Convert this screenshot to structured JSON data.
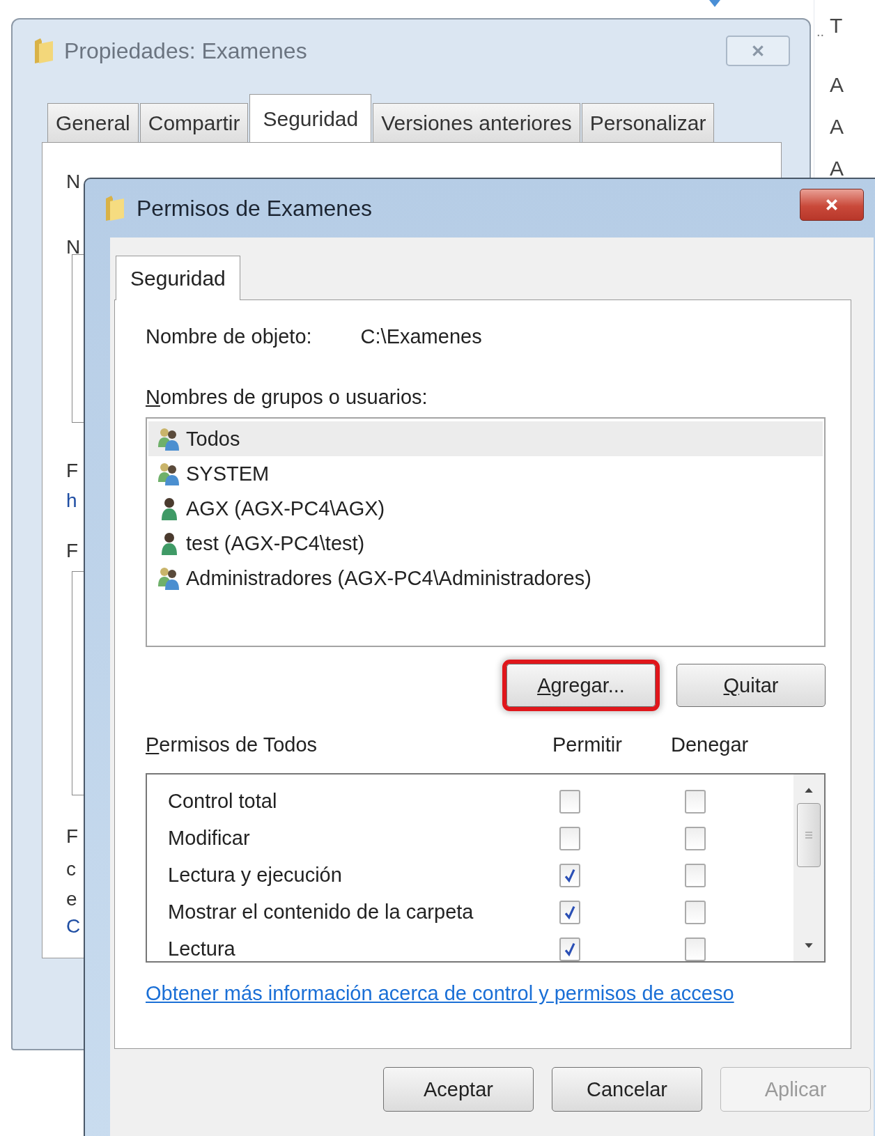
{
  "background_window": {
    "title": "Propiedades: Examenes",
    "tabs": [
      {
        "label": "General",
        "selected": false
      },
      {
        "label": "Compartir",
        "selected": false
      },
      {
        "label": "Seguridad",
        "selected": true
      },
      {
        "label": "Versiones anteriores",
        "selected": false
      },
      {
        "label": "Personalizar",
        "selected": false
      }
    ],
    "clipped_text": [
      {
        "text": "N",
        "kind": "text"
      },
      {
        "text": "N",
        "kind": "text"
      },
      {
        "text": "F",
        "kind": "text"
      },
      {
        "text": "h",
        "kind": "link"
      },
      {
        "text": "F",
        "kind": "text"
      },
      {
        "text": "F",
        "kind": "text"
      },
      {
        "text": "c",
        "kind": "text"
      },
      {
        "text": "e",
        "kind": "text"
      },
      {
        "text": "C",
        "kind": "link"
      }
    ]
  },
  "side_panel": {
    "ellipsis": "..",
    "texts": [
      "T",
      "A",
      "A",
      "A"
    ]
  },
  "dialog": {
    "title": "Permisos de Examenes",
    "tabs": [
      {
        "label": "Seguridad",
        "selected": true
      }
    ],
    "object_name_label": "Nombre de objeto:",
    "object_name": "C:\\Examenes",
    "groups_label": "Nombres de grupos o usuarios:",
    "groups": [
      {
        "name": "Todos",
        "kind": "group",
        "selected": true
      },
      {
        "name": "SYSTEM",
        "kind": "group",
        "selected": false
      },
      {
        "name": "AGX (AGX-PC4\\AGX)",
        "kind": "user",
        "selected": false
      },
      {
        "name": "test (AGX-PC4\\test)",
        "kind": "user",
        "selected": false
      },
      {
        "name": "Administradores (AGX-PC4\\Administradores)",
        "kind": "group",
        "selected": false
      }
    ],
    "group_buttons": [
      {
        "label": "Agregar...",
        "highlighted": true
      },
      {
        "label": "Quitar",
        "highlighted": false
      }
    ],
    "permissions_label": "Permisos de Todos",
    "allow_label": "Permitir",
    "deny_label": "Denegar",
    "permissions": [
      {
        "name": "Control total",
        "allow": false,
        "deny": false
      },
      {
        "name": "Modificar",
        "allow": false,
        "deny": false
      },
      {
        "name": "Lectura y ejecución",
        "allow": true,
        "deny": false
      },
      {
        "name": "Mostrar el contenido de la carpeta",
        "allow": true,
        "deny": false
      },
      {
        "name": "Lectura",
        "allow": true,
        "deny": false
      }
    ],
    "help_link": "Obtener más información acerca de control y permisos de acceso",
    "footer_buttons": [
      {
        "label": "Aceptar",
        "disabled": false
      },
      {
        "label": "Cancelar",
        "disabled": false
      },
      {
        "label": "Aplicar",
        "disabled": true
      }
    ]
  }
}
